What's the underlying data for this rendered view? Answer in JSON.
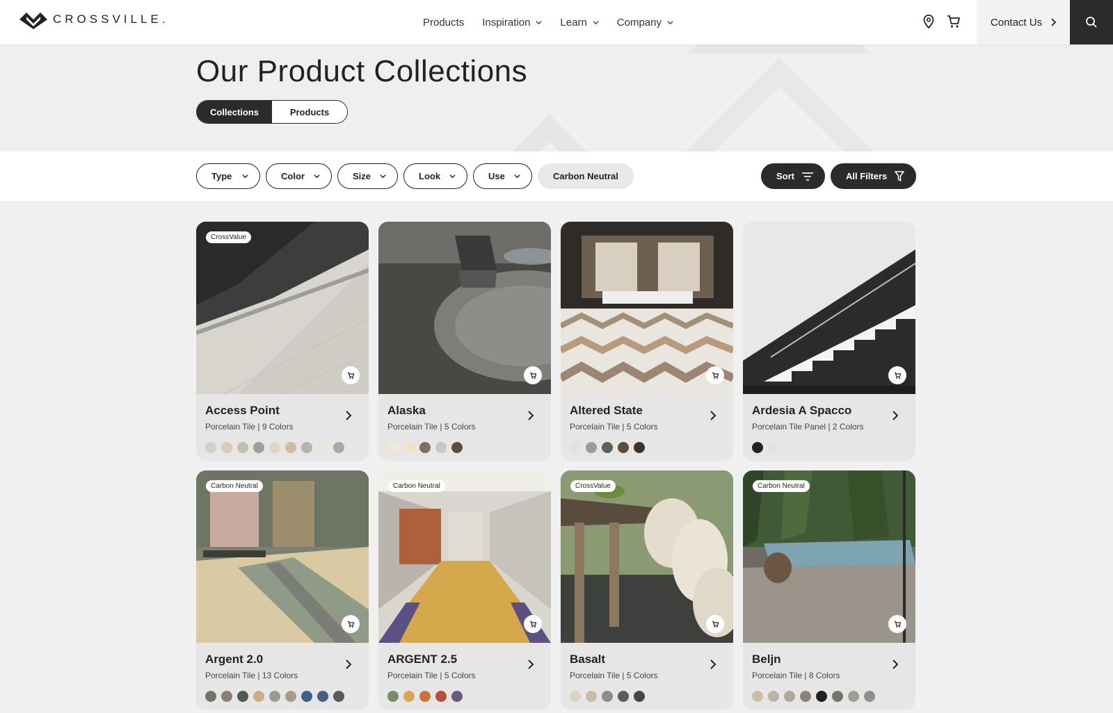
{
  "header": {
    "logo_text": "CROSSVILLE.",
    "nav": [
      {
        "label": "Products",
        "dropdown": false
      },
      {
        "label": "Inspiration",
        "dropdown": true
      },
      {
        "label": "Learn",
        "dropdown": true
      },
      {
        "label": "Company",
        "dropdown": true
      }
    ],
    "location_icon": "map-pin-icon",
    "cart_icon": "cart-icon",
    "contact_label": "Contact Us",
    "search_icon": "search-icon"
  },
  "hero": {
    "title": "Our Product Collections",
    "toggle": [
      {
        "label": "Collections",
        "active": true
      },
      {
        "label": "Products",
        "active": false
      }
    ]
  },
  "filters": {
    "dropdowns": [
      "Type",
      "Color",
      "Size",
      "Look",
      "Use"
    ],
    "chip": "Carbon Neutral",
    "sort_label": "Sort",
    "all_filters_label": "All Filters"
  },
  "colors": {
    "dark": "#2b2b2b",
    "card_bg": "#e6e6e6",
    "page_bg": "#f0f0f0"
  },
  "collections": [
    {
      "name": "Access Point",
      "subtitle": "Porcelain Tile | 9 Colors",
      "badge": "CrossValue",
      "swatches": [
        "#d6cec4",
        "#d9ccbd",
        "#c2bcb1",
        "#a19c94",
        "#e0d6c4",
        "#cfbda2",
        "#b8b2a9",
        "#ece4d8",
        "#a9a7a2"
      ]
    },
    {
      "name": "Alaska",
      "subtitle": "Porcelain Tile | 5 Colors",
      "badge": "",
      "swatches": [
        "#f1e8d8",
        "#efe3c4",
        "#7c6f63",
        "#c8c8c2",
        "#5a4e42"
      ]
    },
    {
      "name": "Altered State",
      "subtitle": "Porcelain Tile | 5 Colors",
      "badge": "",
      "swatches": [
        "#e6e2d7",
        "#9c9c97",
        "#5d605b",
        "#5e4a37",
        "#3d3426"
      ]
    },
    {
      "name": "Ardesia A Spacco",
      "subtitle": "Porcelain Tile Panel | 2 Colors",
      "badge": "",
      "swatches": [
        "#222222",
        "#e7e3dc"
      ]
    },
    {
      "name": "Argent 2.0",
      "subtitle": "Porcelain Tile | 13 Colors",
      "badge": "Carbon Neutral",
      "swatches": [
        "#75716b",
        "#8a8070",
        "#4f5a52",
        "#c8b084",
        "#9a9a94",
        "#a89b8a",
        "#3f6188",
        "#485e82",
        "#5a5a5a"
      ]
    },
    {
      "name": "ARGENT 2.5",
      "subtitle": "Porcelain Tile | 5 Colors",
      "badge": "Carbon Neutral",
      "swatches": [
        "#7a8a63",
        "#d7a758",
        "#c9743f",
        "#b7503a",
        "#6a5a78"
      ]
    },
    {
      "name": "Basalt",
      "subtitle": "Porcelain Tile | 5 Colors",
      "badge": "CrossValue",
      "swatches": [
        "#d8d2c7",
        "#c8bba7",
        "#8d8d88",
        "#5b5e55",
        "#444940"
      ]
    },
    {
      "name": "Beljn",
      "subtitle": "Porcelain Tile | 8 Colors",
      "badge": "Carbon Neutral",
      "swatches": [
        "#cdbda7",
        "#bfb4a3",
        "#b3a89b",
        "#8d8378",
        "#222222",
        "#77736d",
        "#a49d91",
        "#8f8f8f"
      ]
    }
  ]
}
